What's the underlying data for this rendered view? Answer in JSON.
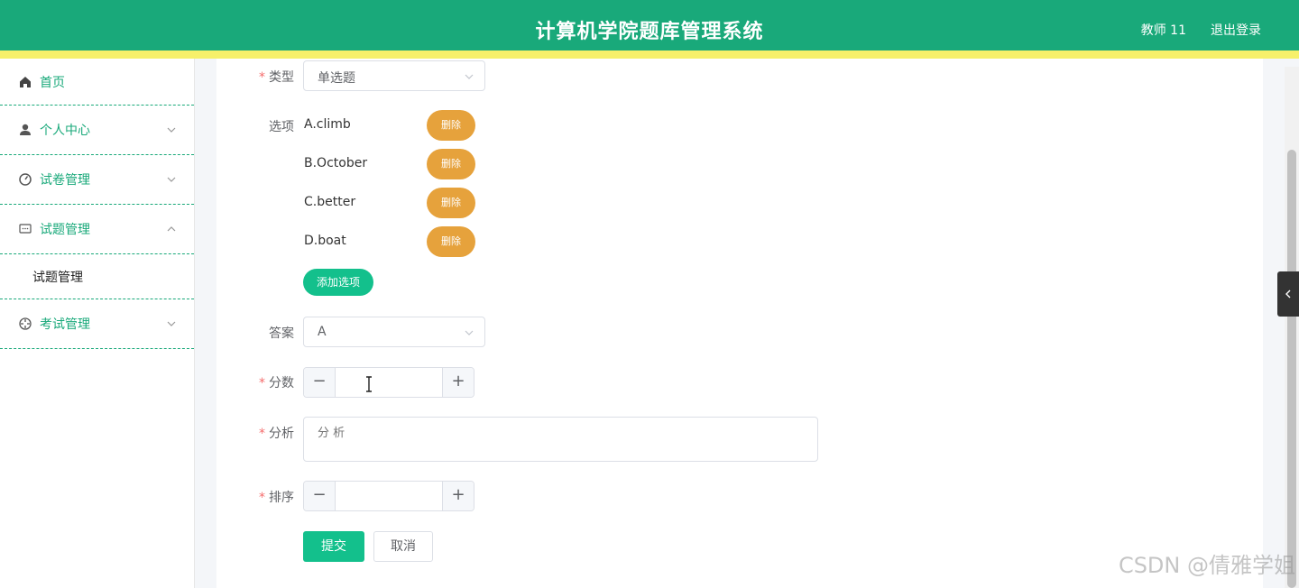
{
  "header": {
    "title": "计算机学院题库管理系统",
    "user": "教师 11",
    "logout": "退出登录"
  },
  "sidebar": {
    "items": [
      {
        "label": "首页",
        "icon": "home-icon"
      },
      {
        "label": "个人中心",
        "icon": "user-icon"
      },
      {
        "label": "试卷管理",
        "icon": "dashboard-icon"
      },
      {
        "label": "试题管理",
        "icon": "message-icon"
      },
      {
        "label": "考试管理",
        "icon": "compass-icon"
      }
    ],
    "submenu": {
      "label": "试题管理"
    }
  },
  "form": {
    "type": {
      "label": "类型",
      "value": "单选题"
    },
    "options": {
      "label": "选项",
      "items": [
        "A.climb",
        "B.October",
        "C.better",
        "D.boat"
      ],
      "delete_label": "删除",
      "add_label": "添加选项"
    },
    "answer": {
      "label": "答案",
      "value": "A"
    },
    "score": {
      "label": "分数",
      "value": ""
    },
    "analysis": {
      "label": "分析",
      "placeholder": "分 析"
    },
    "sort": {
      "label": "排序",
      "value": ""
    },
    "submit_label": "提交",
    "cancel_label": "取消"
  },
  "watermark": "CSDN @倩雅学姐",
  "colors": {
    "primary": "#19a97a",
    "accent_bar": "#f6f06a",
    "delete": "#e6a23c",
    "button": "#13c08c"
  }
}
